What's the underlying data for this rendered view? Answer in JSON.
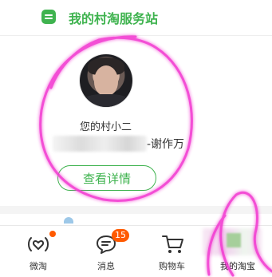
{
  "header": {
    "title": "我的村淘服务站",
    "icon": "station-logo-icon",
    "accent_color": "#3fb34f"
  },
  "card": {
    "agent_label": "您的村小二",
    "thanks_text": "-谢作万",
    "details_button": "查看详情"
  },
  "tabbar": {
    "tabs": [
      {
        "label": "微淘",
        "icon": "weitao-icon"
      },
      {
        "label": "消息",
        "icon": "message-icon",
        "badge": "15"
      },
      {
        "label": "购物车",
        "icon": "cart-icon"
      },
      {
        "label": "我的淘宝",
        "icon": "my-taobao-icon"
      }
    ],
    "badge_color": "#ff5a00"
  },
  "annotation_color": "#f23bd1"
}
